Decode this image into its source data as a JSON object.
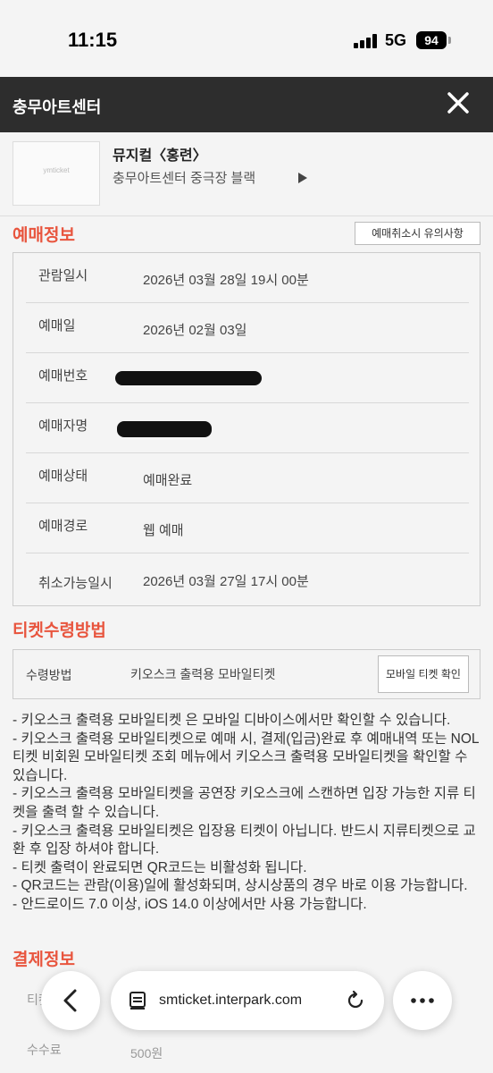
{
  "status": {
    "time": "11:15",
    "network": "5G",
    "battery": "94"
  },
  "header": {
    "title": "충무아트센터",
    "close_icon": "close-icon"
  },
  "performance": {
    "poster_text": "ymticket",
    "title": "뮤지컬〈홍련〉",
    "venue": "충무아트센터 중극장 블랙"
  },
  "booking_info": {
    "title": "예매정보",
    "notice_button": "예매취소시 유의사항",
    "rows": [
      {
        "label": "관람일시",
        "value": "2026년 03월 28일 19시 00분"
      },
      {
        "label": "예매일",
        "value": "2026년 02월 03일"
      },
      {
        "label": "예매번호",
        "value": ""
      },
      {
        "label": "예매자명",
        "value": ""
      },
      {
        "label": "예매상태",
        "value": "예매완료"
      },
      {
        "label": "예매경로",
        "value": "웹 예매"
      },
      {
        "label": "취소가능일시",
        "value": "2026년 03월 27일 17시 00분"
      }
    ]
  },
  "ticket_receipt": {
    "title": "티켓수령방법",
    "label": "수령방법",
    "value": "키오스크 출력용 모바일티켓",
    "button": "모바일 티켓 확인",
    "notes": [
      "- 키오스크 출력용 모바일티켓 은 모바일 디바이스에서만 확인할 수 있습니다.",
      "- 키오스크 출력용 모바일티켓으로 예매 시, 결제(입금)완료 후 예매내역 또는 NOL티켓 비회원 모바일티켓 조회 메뉴에서 키오스크 출력용 모바일티켓을 확인할 수 있습니다.",
      "- 키오스크 출력용 모바일티켓을 공연장 키오스크에 스캔하면 입장 가능한 지류 티켓을 출력 할 수 있습니다.",
      "- 키오스크 출력용 모바일티켓은 입장용 티켓이 아닙니다. 반드시 지류티켓으로 교환 후 입장 하셔야 합니다.",
      "- 티켓 출력이 완료되면 QR코드는 비활성화 됩니다.",
      "- QR코드는 관람(이용)일에 활성화되며, 상시상품의 경우 바로 이용 가능합니다.",
      "- 안드로이드 7.0 이상, iOS 14.0 이상에서만 사용 가능합니다."
    ]
  },
  "payment_info": {
    "title": "결제정보",
    "row1_label": "티켓",
    "row2_label": "수수료",
    "row2_value": "500원"
  },
  "browser": {
    "url": "smticket.interpark.com"
  }
}
